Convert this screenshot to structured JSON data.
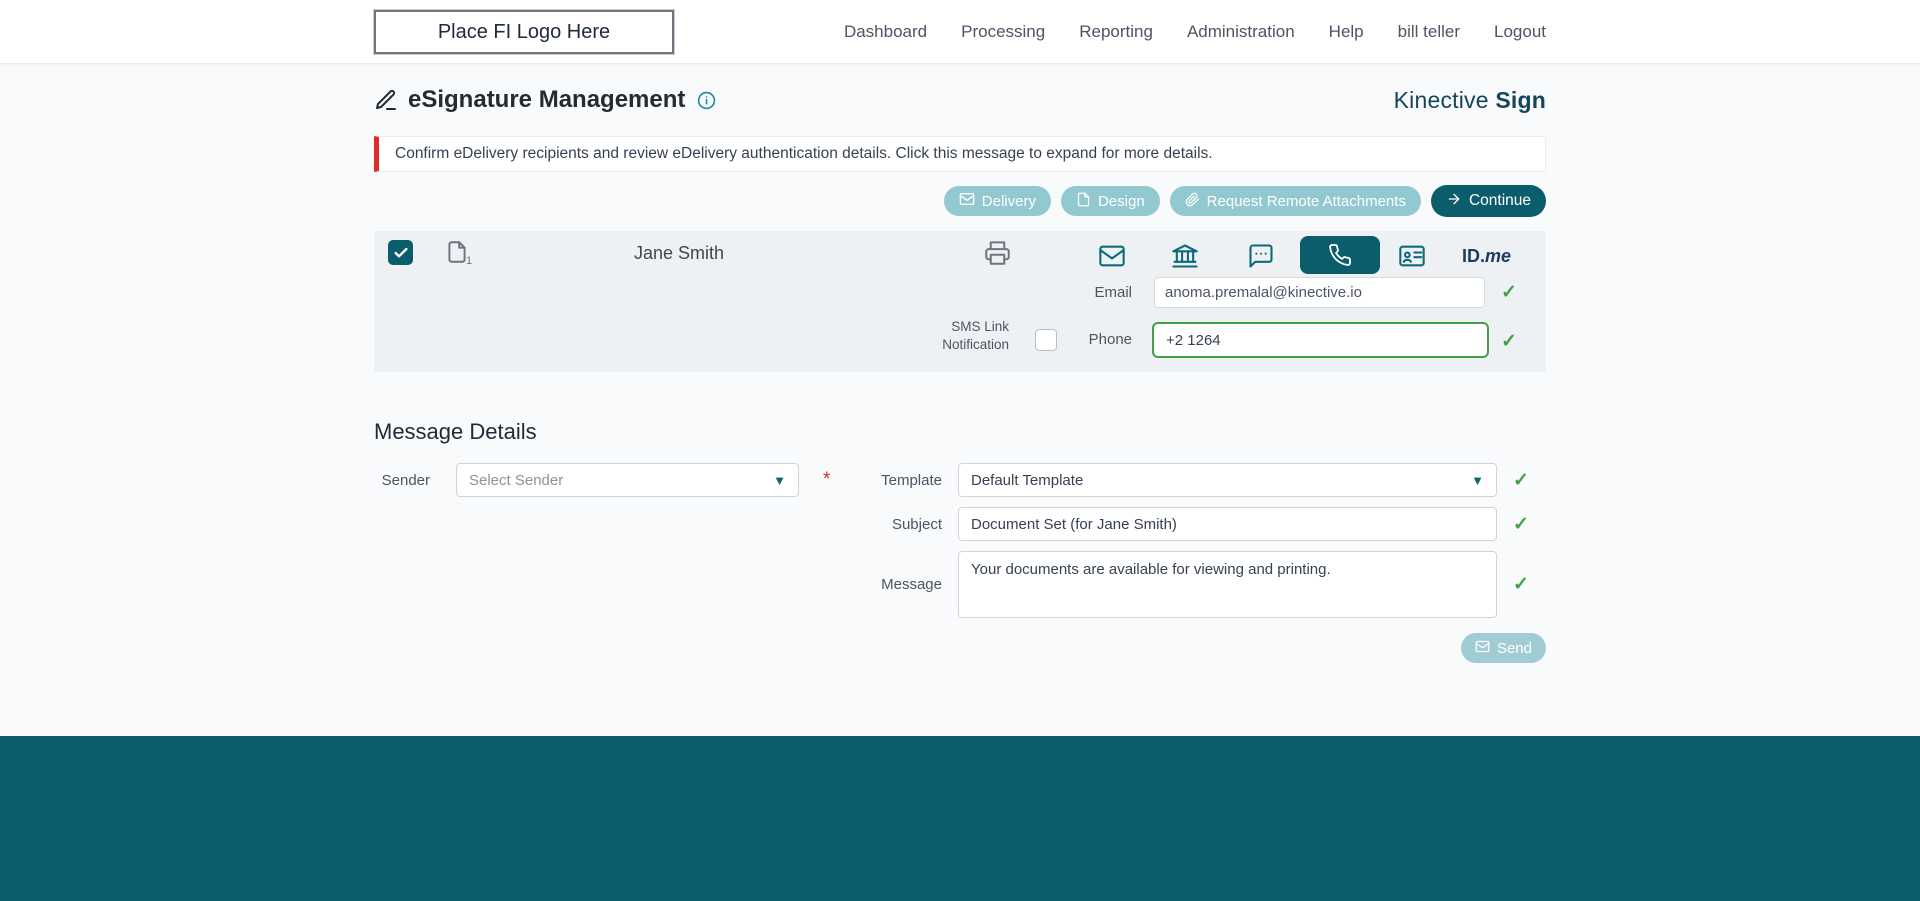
{
  "header": {
    "logo_placeholder": "Place FI Logo Here",
    "nav": [
      {
        "label": "Dashboard"
      },
      {
        "label": "Processing"
      },
      {
        "label": "Reporting"
      },
      {
        "label": "Administration"
      },
      {
        "label": "Help"
      },
      {
        "label": "bill teller"
      },
      {
        "label": "Logout"
      }
    ]
  },
  "brand": {
    "name": "Kinective",
    "product": "Sign"
  },
  "page": {
    "title": "eSignature Management",
    "alert": "Confirm eDelivery recipients and review eDelivery authentication details. Click this message to expand for more details."
  },
  "actions": {
    "delivery": "Delivery",
    "design": "Design",
    "request_remote_attachments": "Request Remote Attachments",
    "continue": "Continue"
  },
  "recipient": {
    "name": "Jane Smith",
    "document_count": "1",
    "email_label": "Email",
    "email_value": "anoma.premalal@kinective.io",
    "sms_link_label_line1": "SMS Link",
    "sms_link_label_line2": "Notification",
    "phone_label": "Phone",
    "phone_value": "+2 1264",
    "idme": {
      "prefix": "ID.",
      "suffix": "me"
    }
  },
  "message_details": {
    "heading": "Message Details",
    "sender_label": "Sender",
    "sender_placeholder": "Select Sender",
    "required_marker": "*",
    "template_label": "Template",
    "template_value": "Default Template",
    "subject_label": "Subject",
    "subject_value": "Document Set (for Jane Smith)",
    "message_label": "Message",
    "message_value": "Your documents are available for viewing and printing.",
    "send_label": "Send"
  },
  "icons": {
    "check": "✓",
    "caret": "▼"
  },
  "colors": {
    "brand_teal_dark": "#0b5d6b",
    "teal_light": "#92c9d0",
    "alert_red": "#e02b2b",
    "success_green": "#43a047",
    "brand_navy": "#15455c"
  }
}
